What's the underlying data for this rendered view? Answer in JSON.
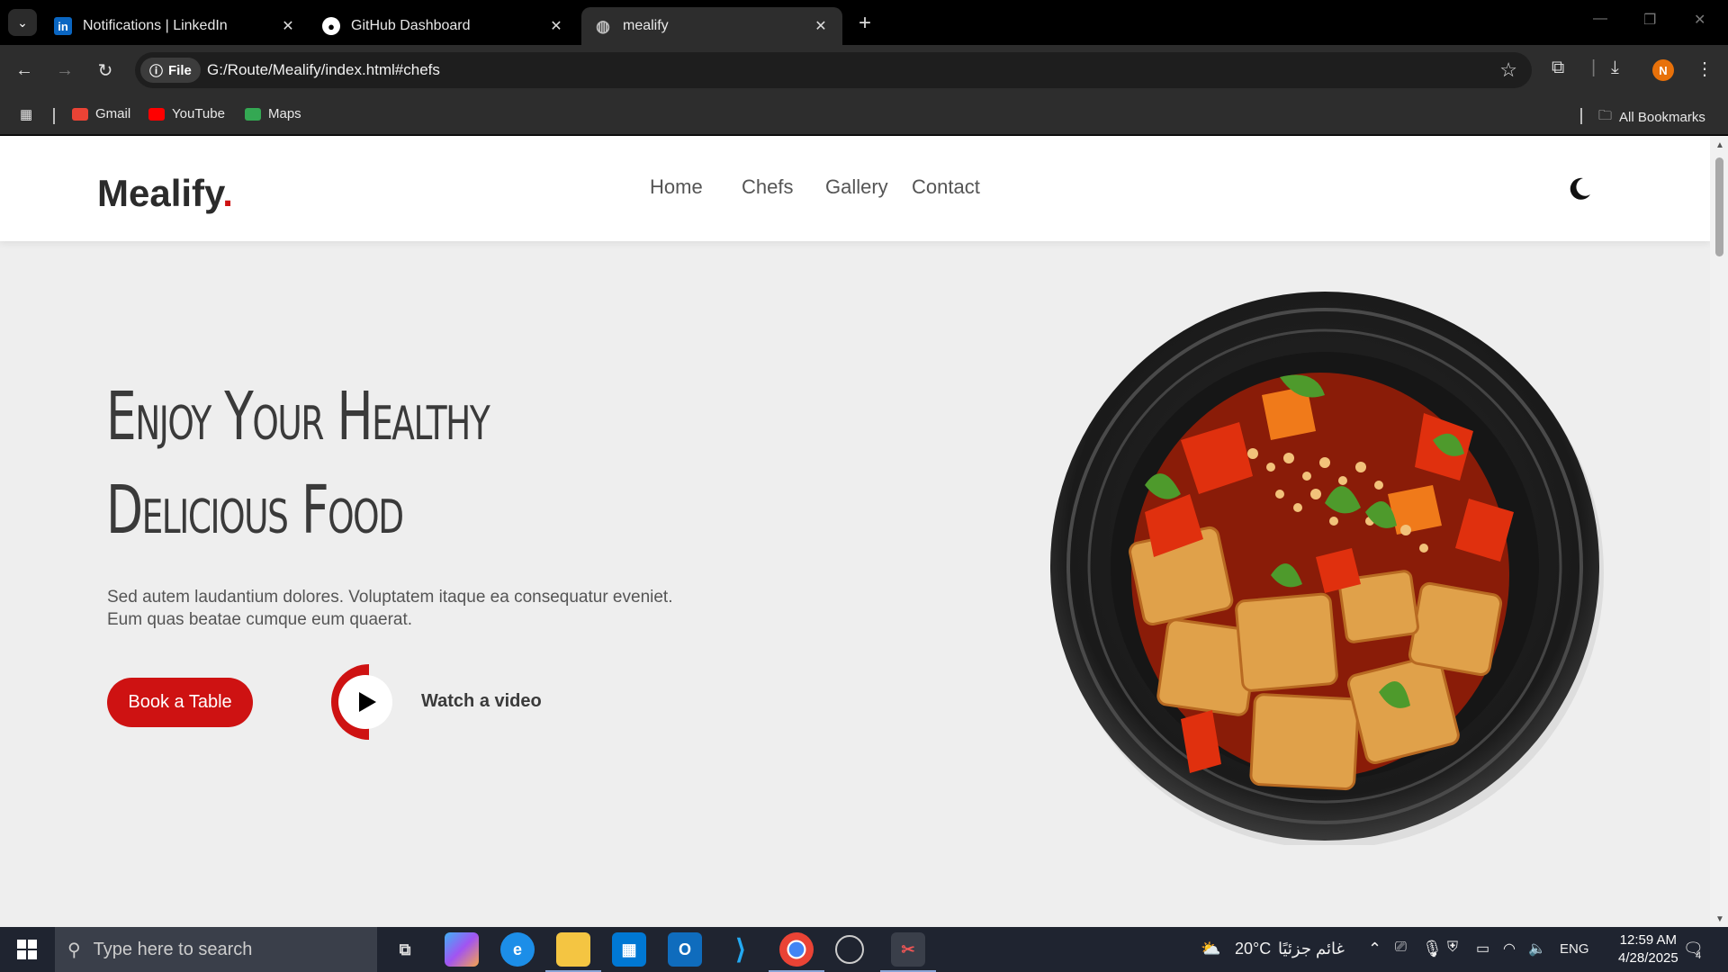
{
  "browser": {
    "tabs": [
      {
        "title": "Notifications | LinkedIn",
        "icon": "linkedin-icon"
      },
      {
        "title": "GitHub Dashboard",
        "icon": "github-icon"
      },
      {
        "title": "mealify",
        "icon": "globe-icon",
        "active": true
      }
    ],
    "site_chip": "File",
    "url": "G:/Route/Mealify/index.html#chefs",
    "avatar_letter": "N",
    "bookmarks": [
      {
        "label": "Gmail",
        "color": "#ea4335"
      },
      {
        "label": "YouTube",
        "color": "#ff0000"
      },
      {
        "label": "Maps",
        "color": "#34a853"
      }
    ],
    "all_bookmarks": "All Bookmarks"
  },
  "site": {
    "logo": "Mealify",
    "logo_dot": ".",
    "accent": "#ce1212",
    "nav": [
      {
        "label": "Home"
      },
      {
        "label": "Chefs"
      },
      {
        "label": "Gallery"
      },
      {
        "label": "Contact"
      }
    ],
    "theme_toggle_icon": "moon-icon"
  },
  "hero": {
    "title_line1": "Enjoy Your Healthy",
    "title_line2": "Delicious Food",
    "desc_line1": "Sed autem laudantium dolores. Voluptatem itaque ea consequatur eveniet.",
    "desc_line2": "Eum quas beatae cumque eum quaerat.",
    "book_label": "Book a Table",
    "watch_label": "Watch a video"
  },
  "taskbar": {
    "search_placeholder": "Type here to search",
    "weather_temp": "20°C",
    "weather_text": "غائم جزئيًا",
    "language": "ENG",
    "time": "12:59 AM",
    "date": "4/28/2025",
    "notification_count": "4"
  }
}
